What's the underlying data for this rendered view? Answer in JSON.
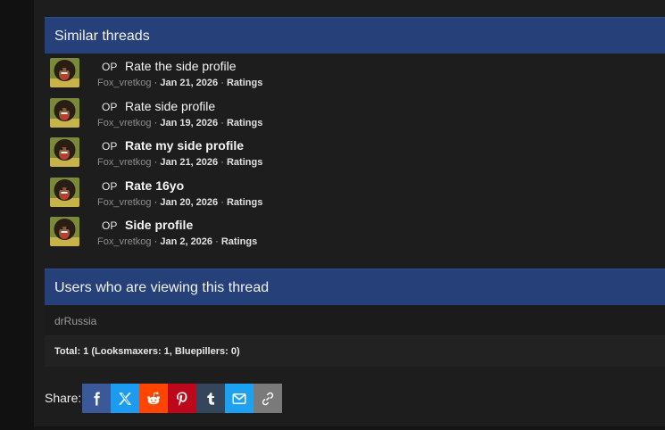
{
  "similar": {
    "heading": "Similar threads",
    "threads": [
      {
        "op": "OP",
        "title": "Rate the side profile",
        "author": "Fox_vretkog",
        "date": "Jan 21, 2026",
        "forum": "Ratings"
      },
      {
        "op": "OP",
        "title": "Rate side profile",
        "author": "Fox_vretkog",
        "date": "Jan 19, 2026",
        "forum": "Ratings"
      },
      {
        "op": "OP",
        "title": "Rate my side profile",
        "author": "Fox_vretkog",
        "date": "Jan 21, 2026",
        "forum": "Ratings"
      },
      {
        "op": "OP",
        "title": "Rate 16yo",
        "author": "Fox_vretkog",
        "date": "Jan 20, 2026",
        "forum": "Ratings"
      },
      {
        "op": "OP",
        "title": "Side profile",
        "author": "Fox_vretkog",
        "date": "Jan 2, 2026",
        "forum": "Ratings"
      }
    ],
    "separator": "·"
  },
  "viewers": {
    "heading": "Users who are viewing this thread",
    "users": [
      "drRussia"
    ],
    "total": "Total: 1 (Looksmaxers: 1, Bluepillers: 0)"
  },
  "share": {
    "label": "Share:",
    "buttons": [
      {
        "name": "facebook",
        "icon": "facebook-icon",
        "color": "#3b5998"
      },
      {
        "name": "x",
        "icon": "x-icon",
        "color": "#1d9bf0"
      },
      {
        "name": "reddit",
        "icon": "reddit-icon",
        "color": "#ff4500"
      },
      {
        "name": "pinterest",
        "icon": "pinterest-icon",
        "color": "#bd081c"
      },
      {
        "name": "tumblr",
        "icon": "tumblr-icon",
        "color": "#35465c"
      },
      {
        "name": "email",
        "icon": "envelope-icon",
        "color": "#1da1f2"
      },
      {
        "name": "link",
        "icon": "link-icon",
        "color": "#7a7a7a"
      }
    ]
  },
  "colors": {
    "block_header": "#26407a",
    "background": "#1d1d1d"
  }
}
